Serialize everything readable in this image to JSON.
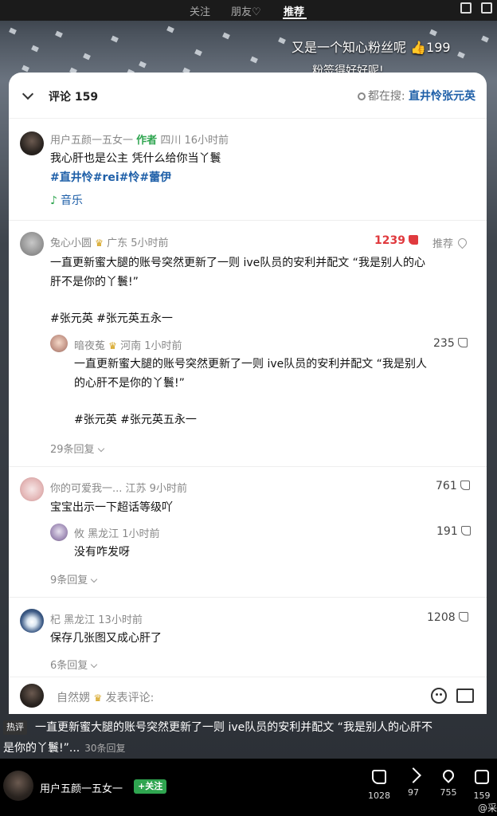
{
  "topnav": {
    "tabs": [
      "关注",
      "朋友♡",
      "推荐"
    ],
    "active": "推荐"
  },
  "video": {
    "caption": "又是一个知心粉丝呢 👍199",
    "caption2": "粉签得好好呢!"
  },
  "header": {
    "title": "评论 159",
    "search_prefix": "都在搜:",
    "search_keyword": "直井怜张元英"
  },
  "author_post": {
    "username": "用户五颜一五女一",
    "badge": "作者",
    "meta": "四川 16小时前",
    "text": "我心肝也是公主 凭什么给你当丫鬟",
    "hashtags": "#直井怜#rei#怜#蕾伊",
    "music_label": "音乐"
  },
  "comments": [
    {
      "username": "兔心小圆",
      "meta": "广东 5小时前",
      "likes": "1239",
      "recommend": "推荐",
      "text_line1": "一直更新蜜大腿的账号突然更新了一则 ive队员的安利并配文 “我是别人的心",
      "text_line2": "肝不是你的丫鬟!”",
      "hashtags": "#张元英 #张元英五永一",
      "reply": {
        "username": "暗夜菟",
        "meta": "河南 1小时前",
        "likes": "235",
        "text_line1": "一直更新蜜大腿的账号突然更新了一则 ive队员的安利并配文 “我是别人",
        "text_line2": "的心肝不是你的丫鬟!”",
        "hashtags": "#张元英 #张元英五永一"
      },
      "more": "29条回复"
    },
    {
      "username": "你的可爱我一...",
      "meta": "江苏 9小时前",
      "likes": "761",
      "text": "宝宝出示一下超话等级吖",
      "reply": {
        "username": "攸",
        "meta": "黑龙江 1小时前",
        "likes": "191",
        "text": "没有咋发呀"
      },
      "more": "9条回复"
    },
    {
      "username": "杞",
      "meta": "黑龙江 13小时前",
      "likes": "1208",
      "text": "保存几张图又成心肝了",
      "more": "6条回复"
    }
  ],
  "input": {
    "username": "自然娚",
    "placeholder": "发表评论:"
  },
  "hot_strip": {
    "tag": "热评",
    "line1": "一直更新蜜大腿的账号突然更新了一则 ive队员的安利并配文 “我是别人的心肝不",
    "line2": "是你的丫鬟!”...",
    "count": "30条回复"
  },
  "bottom": {
    "username": "用户五颜一五女一",
    "follow": "+关注",
    "stats": {
      "likes": "1028",
      "shares": "97",
      "favorites": "755",
      "comments": "159"
    },
    "watermark": "@采"
  },
  "colors": {
    "accent_green": "#2fa550",
    "link_blue": "#1e5fa8",
    "hot_red": "#e03a3e"
  }
}
